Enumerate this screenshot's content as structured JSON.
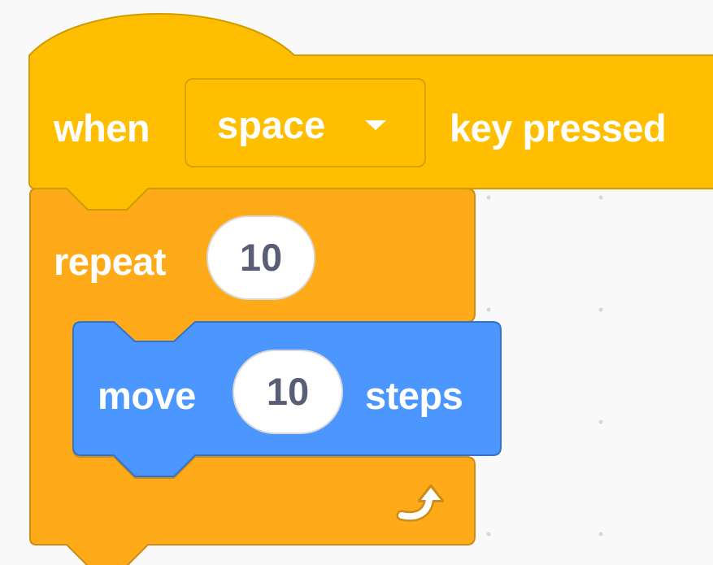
{
  "hat_block": {
    "label_when": "when",
    "key_dropdown": {
      "value": "space"
    },
    "label_suffix": "key pressed",
    "color": "#ffbf00",
    "border_color": "#cf9d00"
  },
  "repeat_block": {
    "label": "repeat",
    "count": "10",
    "color": "#ffab19",
    "border_color": "#cf8b17"
  },
  "move_block": {
    "label_prefix": "move",
    "steps": "10",
    "label_suffix": "steps",
    "color": "#4c97ff",
    "border_color": "#3373cc"
  },
  "icons": {
    "dropdown_caret": "chevron-down-icon",
    "loop_arrow": "repeat-arrow-icon"
  }
}
